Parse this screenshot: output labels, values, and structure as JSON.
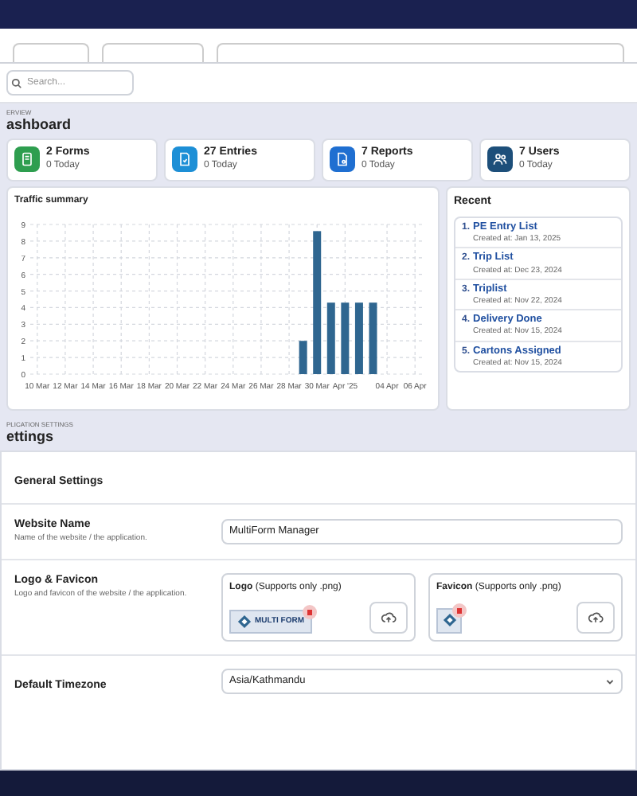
{
  "search": {
    "placeholder": "Search..."
  },
  "dashboard": {
    "eyebrow": "ERVIEW",
    "title": "ashboard"
  },
  "stats": [
    {
      "label": "2 Forms",
      "sub": "0 Today",
      "color": "#2e9e4f"
    },
    {
      "label": "27 Entries",
      "sub": "0 Today",
      "color": "#1d8fd6"
    },
    {
      "label": "7 Reports",
      "sub": "0 Today",
      "color": "#1f6fd1"
    },
    {
      "label": "7 Users",
      "sub": "0 Today",
      "color": "#1d4f7a"
    }
  ],
  "traffic": {
    "title": "Traffic summary",
    "chart_data": {
      "type": "bar",
      "categories": [
        "10 Mar",
        null,
        "12 Mar",
        null,
        "14 Mar",
        null,
        "16 Mar",
        null,
        "18 Mar",
        null,
        "20 Mar",
        null,
        "22 Mar",
        null,
        "24 Mar",
        null,
        "26 Mar",
        null,
        "28 Mar",
        null,
        "30 Mar",
        null,
        "Apr '25",
        null,
        null,
        "04 Apr",
        null,
        "06 Apr"
      ],
      "series": [
        {
          "color": "#2f6690",
          "values": [
            null,
            null,
            null,
            null,
            null,
            null,
            null,
            null,
            null,
            null,
            null,
            null,
            null,
            null,
            null,
            null,
            null,
            null,
            null,
            2,
            8.6,
            4.3,
            4.3,
            4.3,
            4.3,
            null,
            null,
            null
          ]
        }
      ],
      "ylim": [
        0,
        9
      ],
      "grid": true,
      "yticks": [
        0,
        1,
        2,
        3,
        4,
        5,
        6,
        7,
        8,
        9
      ]
    }
  },
  "recent": {
    "title": "Recent",
    "items": [
      {
        "number": "1.",
        "title": "PE Entry List",
        "created": "Created at: Jan 13, 2025"
      },
      {
        "number": "2.",
        "title": "Trip List",
        "created": "Created at: Dec 23, 2024"
      },
      {
        "number": "3.",
        "title": "Triplist",
        "created": "Created at: Nov 22, 2024"
      },
      {
        "number": "4.",
        "title": "Delivery Done",
        "created": "Created at: Nov 15, 2024"
      },
      {
        "number": "5.",
        "title": "Cartons Assigned",
        "created": "Created at: Nov 15, 2024"
      }
    ]
  },
  "settings": {
    "eyebrow": "PLICATION SETTINGS",
    "title": "ettings",
    "section": "General Settings",
    "website_name": {
      "label": "Website Name",
      "hint": "Name of the website / the application.",
      "value": "MultiForm Manager"
    },
    "logo_favicon": {
      "label": "Logo & Favicon",
      "hint": "Logo and favicon of the website / the application.",
      "logo": {
        "label": "Logo",
        "note": "(Supports only .png)",
        "logo_text": "MULTI FORM"
      },
      "favicon": {
        "label": "Favicon",
        "note": "(Supports only .png)"
      }
    },
    "timezone": {
      "label": "Default Timezone",
      "value": "Asia/Kathmandu"
    }
  }
}
